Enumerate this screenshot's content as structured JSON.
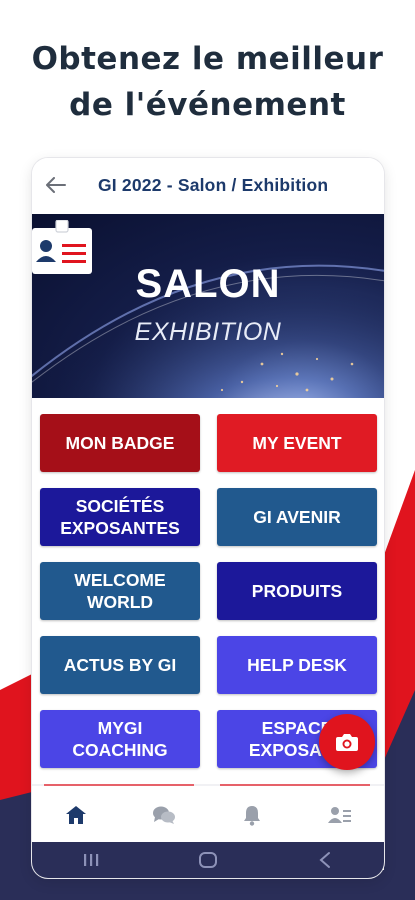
{
  "headline": {
    "line1": "Obtenez le meilleur",
    "line2": "de l'événement"
  },
  "app": {
    "back_icon": "arrow-left-icon",
    "title": "GI 2022 - Salon / Exhibition"
  },
  "banner": {
    "title": "SALON",
    "subtitle": "EXHIBITION",
    "badge_icon": "id-badge-icon"
  },
  "tiles": [
    {
      "label": "MON BADGE",
      "color": "#a50f18"
    },
    {
      "label": "MY EVENT",
      "color": "#e01b24"
    },
    {
      "label": "SOCIÉTÉS\nEXPOSANTES",
      "color": "#1c189a"
    },
    {
      "label": "GI AVENIR",
      "color": "#21598e"
    },
    {
      "label": "WELCOME\nWORLD",
      "color": "#21598e"
    },
    {
      "label": "PRODUITS",
      "color": "#1c189a"
    },
    {
      "label": "ACTUS BY GI",
      "color": "#21598e"
    },
    {
      "label": "HELP DESK",
      "color": "#4b45e6"
    },
    {
      "label": "MYGI\nCOACHING",
      "color": "#4b45e6"
    },
    {
      "label": "ESPACE\nEXPOSANT",
      "color": "#4b45e6"
    }
  ],
  "fab": {
    "icon": "camera-icon",
    "color": "#e0141e"
  },
  "bottom_nav": [
    {
      "icon": "home-icon",
      "active": true
    },
    {
      "icon": "chat-icon",
      "active": false
    },
    {
      "icon": "bell-icon",
      "active": false
    },
    {
      "icon": "contact-list-icon",
      "active": false
    }
  ],
  "system_nav": [
    "recents-icon",
    "home-pill-icon",
    "back-chevron-icon"
  ],
  "colors": {
    "navy": "#1d3a6b",
    "red": "#e0141e",
    "bg_navy": "#2a2e58"
  }
}
